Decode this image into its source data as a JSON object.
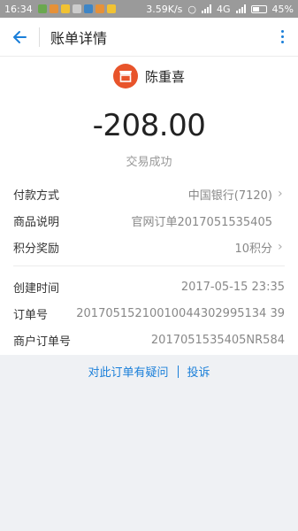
{
  "status_bar": {
    "time": "16:34",
    "speed": "3.59K/s",
    "network": "4G",
    "battery": "45%",
    "app_icon_colors": [
      "#6aa84f",
      "#e69138",
      "#f1c232",
      "#cccccc",
      "#3d85c6",
      "#e69138",
      "#f1c232"
    ]
  },
  "header": {
    "title": "账单详情"
  },
  "merchant": {
    "name": "陈重喜",
    "icon": "shop-icon",
    "icon_color": "#e8542b"
  },
  "transaction": {
    "amount": "-208.00",
    "status": "交易成功"
  },
  "details": [
    {
      "label": "付款方式",
      "value": "中国银行(7120)",
      "chevron": true
    },
    {
      "label": "商品说明",
      "value": "官网订单2017051535405",
      "chevron": false
    },
    {
      "label": "积分奖励",
      "value": "10积分",
      "chevron": true
    }
  ],
  "meta": [
    {
      "label": "创建时间",
      "value": "2017-05-15 23:35"
    },
    {
      "label": "订单号",
      "value": "20170515210010044302995134 39"
    },
    {
      "label": "商户订单号",
      "value": "2017051535405NR584"
    }
  ],
  "footer": {
    "question_link": "对此订单有疑问",
    "complain_link": "投诉"
  },
  "colors": {
    "accent": "#1a7fd9",
    "background": "#eff1f4"
  }
}
